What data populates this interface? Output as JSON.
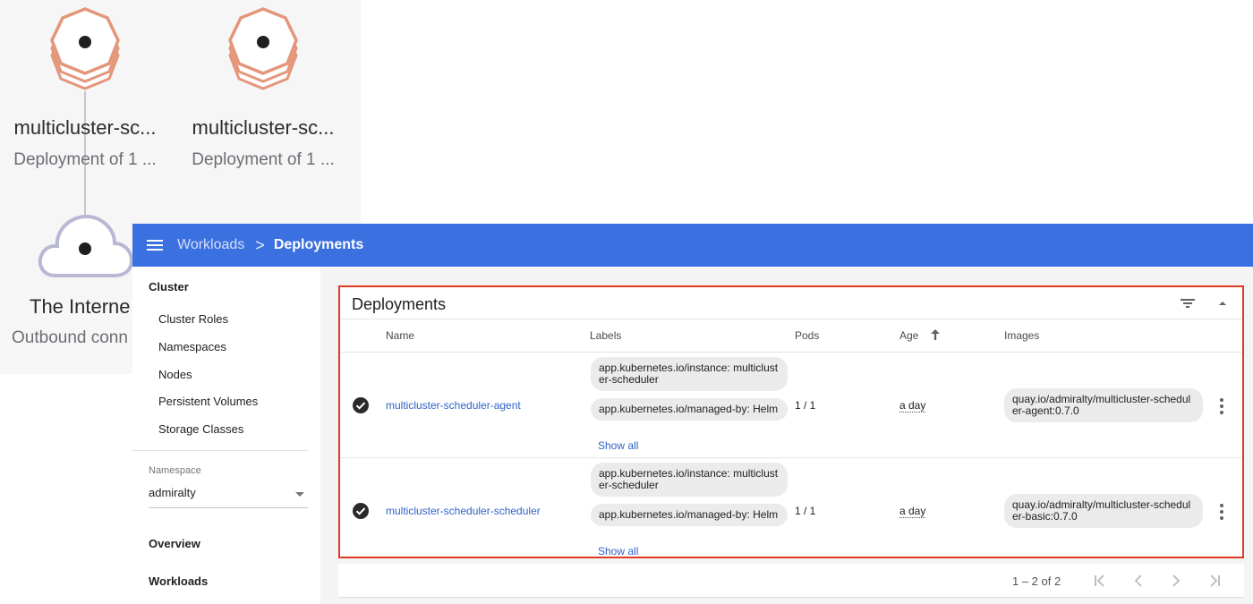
{
  "graph": {
    "nodes": [
      {
        "title": "multicluster-sc...",
        "subtitle": "Deployment of 1 ..."
      },
      {
        "title": "multicluster-sc...",
        "subtitle": "Deployment of 1 ..."
      }
    ],
    "internet": {
      "title": "The Interne",
      "subtitle": "Outbound conn"
    },
    "colors": {
      "deployment": "#e4967a",
      "cloud": "#b8b8d4"
    }
  },
  "toolbar": {
    "menu_icon": "hamburger-menu-icon",
    "breadcrumb": {
      "parent": "Workloads",
      "separator": ">",
      "current": "Deployments"
    },
    "color": "#3b70e0"
  },
  "sidebar": {
    "cluster_heading": "Cluster",
    "cluster_items": [
      "Cluster Roles",
      "Namespaces",
      "Nodes",
      "Persistent Volumes",
      "Storage Classes"
    ],
    "namespace_label": "Namespace",
    "namespace_value": "admiralty",
    "overview": "Overview",
    "workloads": "Workloads"
  },
  "deployments": {
    "title": "Deployments",
    "filter_icon": "filter-icon",
    "collapse_icon": "collapse-icon",
    "columns": {
      "name": "Name",
      "labels": "Labels",
      "pods": "Pods",
      "age": "Age",
      "images": "Images"
    },
    "sort": {
      "column": "Age",
      "direction": "ascending"
    },
    "rows": [
      {
        "status": "running",
        "name": "multicluster-scheduler-agent",
        "labels": [
          "app.kubernetes.io/instance: multicluster-scheduler",
          "app.kubernetes.io/managed-by: Helm"
        ],
        "show_all": "Show all",
        "pods": "1 / 1",
        "age": "a day",
        "image": "quay.io/admiralty/multicluster-scheduler-agent:0.7.0"
      },
      {
        "status": "running",
        "name": "multicluster-scheduler-scheduler",
        "labels": [
          "app.kubernetes.io/instance: multicluster-scheduler",
          "app.kubernetes.io/managed-by: Helm"
        ],
        "show_all": "Show all",
        "pods": "1 / 1",
        "age": "a day",
        "image": "quay.io/admiralty/multicluster-scheduler-basic:0.7.0"
      }
    ],
    "highlight_color": "#de3b24"
  },
  "pagination": {
    "range": "1 – 2 of 2",
    "buttons": [
      "first-page-icon",
      "previous-page-icon",
      "next-page-icon",
      "last-page-icon"
    ]
  }
}
